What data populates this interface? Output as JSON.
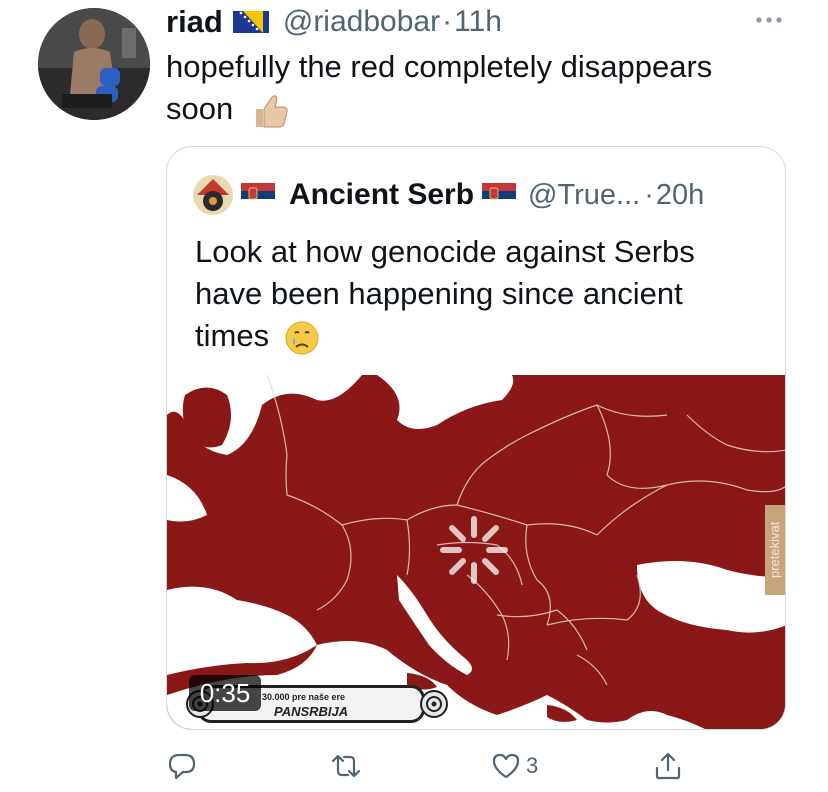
{
  "tweet": {
    "author_name": "riad",
    "author_handle": "@riadbobar",
    "separator": "·",
    "time": "11h",
    "text": "hopefully the red completely disappears soon",
    "flag_icon": "bosnia-flag-icon",
    "emoji_icon": "thumbs-up-icon"
  },
  "quoted": {
    "author_name": "Ancient Serb",
    "author_handle": "@True...",
    "separator": "·",
    "time": "20h",
    "text": "Look at how genocide against Serbs have been happening since ancient times",
    "flag_icon": "serbia-flag-icon",
    "emoji_icon": "crying-face-icon",
    "media": {
      "duration": "0:35",
      "caption": "30.000 pre naše ere",
      "banner_title": "PANSRBIJA",
      "watermark": "pretekivat",
      "map_color": "#8a1817"
    }
  },
  "actions": {
    "reply_count": "",
    "retweet_count": "",
    "like_count": "3",
    "share_count": ""
  },
  "colors": {
    "text": "#0f1419",
    "secondary": "#536471",
    "border": "#cfd9de",
    "map_red": "#8a1817"
  }
}
